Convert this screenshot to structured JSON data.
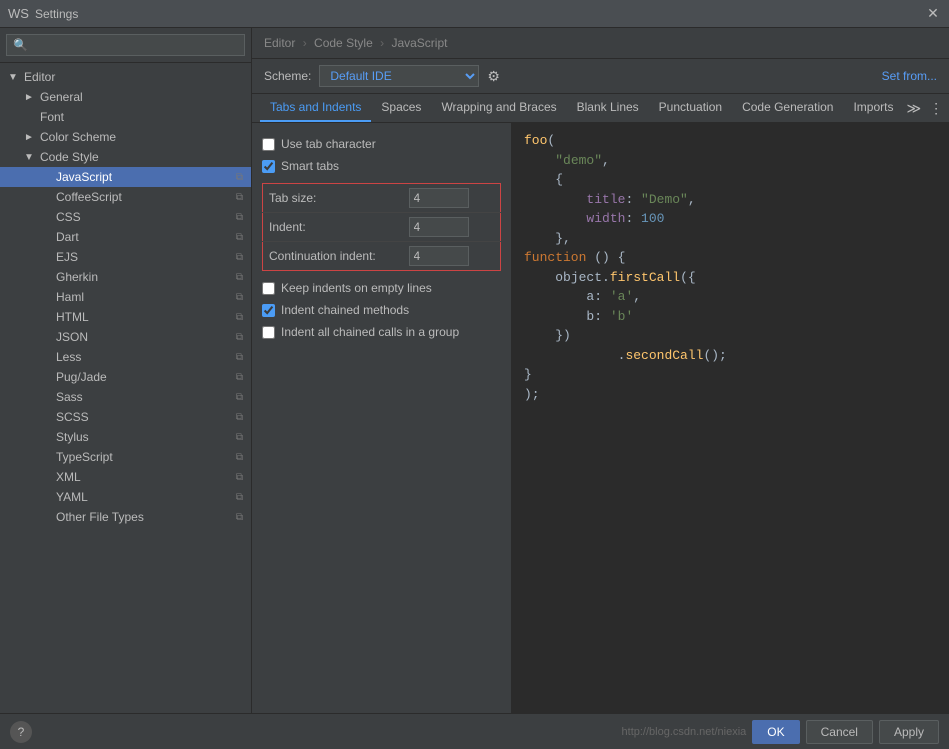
{
  "titleBar": {
    "icon": "WS",
    "title": "Settings",
    "closeLabel": "✕"
  },
  "breadcrumb": {
    "parts": [
      "Editor",
      "Code Style",
      "JavaScript"
    ],
    "sep": "›"
  },
  "scheme": {
    "label": "Scheme:",
    "value": "Default",
    "suffix": "IDE",
    "setFromLabel": "Set from..."
  },
  "tabs": [
    {
      "id": "tabs-indents",
      "label": "Tabs and Indents",
      "active": true
    },
    {
      "id": "spaces",
      "label": "Spaces",
      "active": false
    },
    {
      "id": "wrapping",
      "label": "Wrapping and Braces",
      "active": false
    },
    {
      "id": "blank-lines",
      "label": "Blank Lines",
      "active": false
    },
    {
      "id": "punctuation",
      "label": "Punctuation",
      "active": false
    },
    {
      "id": "code-generation",
      "label": "Code Generation",
      "active": false
    },
    {
      "id": "imports",
      "label": "Imports",
      "active": false
    }
  ],
  "settings": {
    "useTabCharacter": {
      "label": "Use tab character",
      "checked": false
    },
    "smartTabs": {
      "label": "Smart tabs",
      "checked": true
    },
    "tabSize": {
      "label": "Tab size:",
      "value": "4"
    },
    "indent": {
      "label": "Indent:",
      "value": "4"
    },
    "continuationIndent": {
      "label": "Continuation indent:",
      "value": "4"
    },
    "keepIndentsOnEmptyLines": {
      "label": "Keep indents on empty lines",
      "checked": false
    },
    "indentChainedMethods": {
      "label": "Indent chained methods",
      "checked": true
    },
    "indentAllChainedCalls": {
      "label": "Indent all chained calls in a group",
      "checked": false
    }
  },
  "sidebar": {
    "searchPlaceholder": "🔍",
    "items": [
      {
        "id": "editor",
        "label": "Editor",
        "level": 0,
        "expand": "▼",
        "indent": 0
      },
      {
        "id": "general",
        "label": "General",
        "level": 1,
        "expand": "►",
        "indent": 1
      },
      {
        "id": "font",
        "label": "Font",
        "level": 1,
        "expand": "",
        "indent": 1
      },
      {
        "id": "color-scheme",
        "label": "Color Scheme",
        "level": 1,
        "expand": "►",
        "indent": 1
      },
      {
        "id": "code-style",
        "label": "Code Style",
        "level": 1,
        "expand": "▼",
        "indent": 1
      },
      {
        "id": "javascript",
        "label": "JavaScript",
        "level": 2,
        "expand": "",
        "indent": 2,
        "selected": true
      },
      {
        "id": "coffeescript",
        "label": "CoffeeScript",
        "level": 2,
        "expand": "",
        "indent": 2
      },
      {
        "id": "css",
        "label": "CSS",
        "level": 2,
        "expand": "",
        "indent": 2
      },
      {
        "id": "dart",
        "label": "Dart",
        "level": 2,
        "expand": "",
        "indent": 2
      },
      {
        "id": "ejs",
        "label": "EJS",
        "level": 2,
        "expand": "",
        "indent": 2
      },
      {
        "id": "gherkin",
        "label": "Gherkin",
        "level": 2,
        "expand": "",
        "indent": 2
      },
      {
        "id": "haml",
        "label": "Haml",
        "level": 2,
        "expand": "",
        "indent": 2
      },
      {
        "id": "html",
        "label": "HTML",
        "level": 2,
        "expand": "",
        "indent": 2
      },
      {
        "id": "json",
        "label": "JSON",
        "level": 2,
        "expand": "",
        "indent": 2
      },
      {
        "id": "less",
        "label": "Less",
        "level": 2,
        "expand": "",
        "indent": 2
      },
      {
        "id": "pugjade",
        "label": "Pug/Jade",
        "level": 2,
        "expand": "",
        "indent": 2
      },
      {
        "id": "sass",
        "label": "Sass",
        "level": 2,
        "expand": "",
        "indent": 2
      },
      {
        "id": "scss",
        "label": "SCSS",
        "level": 2,
        "expand": "",
        "indent": 2
      },
      {
        "id": "stylus",
        "label": "Stylus",
        "level": 2,
        "expand": "",
        "indent": 2
      },
      {
        "id": "typescript",
        "label": "TypeScript",
        "level": 2,
        "expand": "",
        "indent": 2
      },
      {
        "id": "xml",
        "label": "XML",
        "level": 2,
        "expand": "",
        "indent": 2
      },
      {
        "id": "yaml",
        "label": "YAML",
        "level": 2,
        "expand": "",
        "indent": 2
      },
      {
        "id": "other-file-types",
        "label": "Other File Types",
        "level": 2,
        "expand": "",
        "indent": 2
      }
    ]
  },
  "bottomBar": {
    "helpIcon": "?",
    "watermark": "http://blog.csdn.net/niexia",
    "okLabel": "OK",
    "cancelLabel": "Cancel",
    "applyLabel": "Apply"
  }
}
